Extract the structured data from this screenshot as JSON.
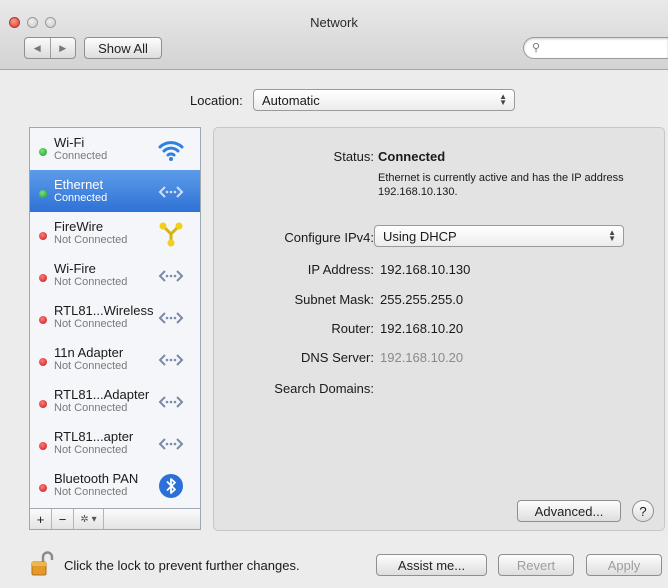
{
  "window": {
    "title": "Network"
  },
  "toolbar": {
    "back_glyph": "◀",
    "forward_glyph": "▶",
    "show_all": "Show All",
    "search_placeholder": "",
    "search_icon": "⚲"
  },
  "location": {
    "label": "Location:",
    "value": "Automatic"
  },
  "services": [
    {
      "name": "Wi-Fi",
      "status": "Connected",
      "state": "green",
      "icon": "wifi-icon",
      "selected": false
    },
    {
      "name": "Ethernet",
      "status": "Connected",
      "state": "green",
      "icon": "ethernet-icon",
      "selected": true
    },
    {
      "name": "FireWire",
      "status": "Not Connected",
      "state": "red",
      "icon": "firewire-icon",
      "selected": false
    },
    {
      "name": "Wi-Fire",
      "status": "Not Connected",
      "state": "red",
      "icon": "ethernet-icon",
      "selected": false
    },
    {
      "name": "RTL81...Wireless",
      "status": "Not Connected",
      "state": "red",
      "icon": "ethernet-icon",
      "selected": false
    },
    {
      "name": "11n Adapter",
      "status": "Not Connected",
      "state": "red",
      "icon": "ethernet-icon",
      "selected": false
    },
    {
      "name": "RTL81...Adapter",
      "status": "Not Connected",
      "state": "red",
      "icon": "ethernet-icon",
      "selected": false
    },
    {
      "name": "RTL81...apter",
      "status": "Not Connected",
      "state": "red",
      "icon": "ethernet-icon",
      "selected": false
    },
    {
      "name": "Bluetooth PAN",
      "status": "Not Connected",
      "state": "red",
      "icon": "bluetooth-icon",
      "selected": false
    }
  ],
  "list_toolbar": {
    "add": "+",
    "remove": "−",
    "gear": "✲ ▾"
  },
  "detail": {
    "status_label": "Status:",
    "status_value": "Connected",
    "status_description": "Ethernet is currently active and has the IP address 192.168.10.130.",
    "configure_label": "Configure IPv4:",
    "configure_value": "Using DHCP",
    "ip_label": "IP Address:",
    "ip_value": "192.168.10.130",
    "subnet_label": "Subnet Mask:",
    "subnet_value": "255.255.255.0",
    "router_label": "Router:",
    "router_value": "192.168.10.20",
    "dns_label": "DNS Server:",
    "dns_value": "192.168.10.20",
    "search_domains_label": "Search Domains:",
    "advanced_button": "Advanced...",
    "help_button": "?"
  },
  "footer": {
    "lock_text": "Click the lock to prevent further changes.",
    "assist_button": "Assist me...",
    "revert_button": "Revert",
    "apply_button": "Apply"
  },
  "colors": {
    "selection": "#3a7fde",
    "connected": "#1e9a24",
    "not_connected": "#c81616"
  }
}
